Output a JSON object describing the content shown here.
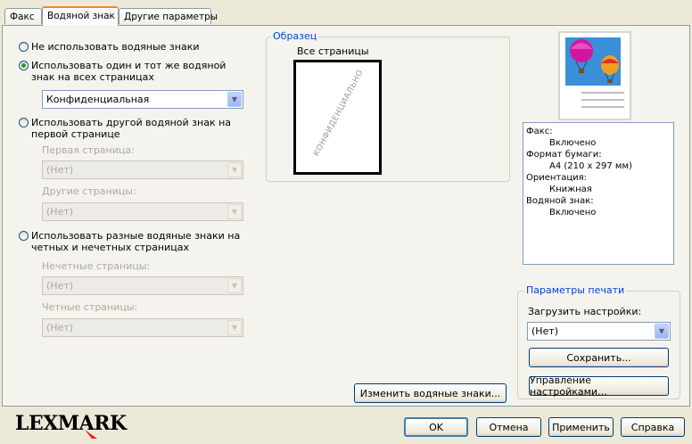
{
  "tabs": [
    {
      "label": "Факс"
    },
    {
      "label": "Водяной знак"
    },
    {
      "label": "Другие параметры"
    }
  ],
  "watermark": {
    "options": [
      {
        "label": "Не использовать водяные знаки",
        "checked": false
      },
      {
        "label": "Использовать один и тот же водяной знак на всех страницах",
        "checked": true
      },
      {
        "label": "Использовать другой водяной знак на первой странице",
        "checked": false
      },
      {
        "label": "Использовать разные водяные знаки на четных и нечетных страницах",
        "checked": false
      }
    ],
    "same_all_value": "Конфиденциальная",
    "first_page_label": "Первая страница:",
    "first_page_value": "(Нет)",
    "other_pages_label": "Другие страницы:",
    "other_pages_value": "(Нет)",
    "odd_pages_label": "Нечетные страницы:",
    "odd_pages_value": "(Нет)",
    "even_pages_label": "Четные страницы:",
    "even_pages_value": "(Нет)"
  },
  "sample": {
    "title": "Образец",
    "caption": "Все страницы",
    "watermark_text": "КОНФИДЕНЦИАЛЬНО",
    "edit_button": "Изменить водяные знаки..."
  },
  "summary": [
    {
      "text": "Факс:",
      "indent": false
    },
    {
      "text": "Включено",
      "indent": true
    },
    {
      "text": "Формат бумаги:",
      "indent": false
    },
    {
      "text": "A4 (210 x 297 мм)",
      "indent": true
    },
    {
      "text": "Ориентация:",
      "indent": false
    },
    {
      "text": "Книжная",
      "indent": true
    },
    {
      "text": "Водяной знак:",
      "indent": false
    },
    {
      "text": "Включено",
      "indent": true
    }
  ],
  "print_params": {
    "title": "Параметры печати",
    "load_label": "Загрузить настройки:",
    "load_value": "(Нет)",
    "save_button": "Сохранить...",
    "manage_button": "Управление настройками..."
  },
  "footer": {
    "brand": "LEXMARK",
    "ok": "OK",
    "cancel": "Отмена",
    "apply": "Применить",
    "help": "Справка"
  },
  "colors": {
    "accent": "#0046d5",
    "brand": "#000000",
    "brand_mark": "#e2231a",
    "radio_checked": "#21a121"
  }
}
